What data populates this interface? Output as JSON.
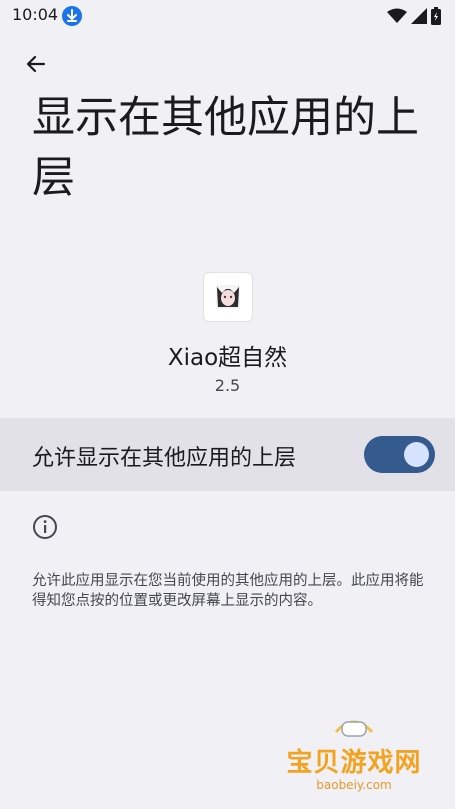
{
  "status_bar": {
    "time": "10:04"
  },
  "header": {
    "title": "显示在其他应用的上层"
  },
  "app": {
    "name": "Xiao超自然",
    "version": "2.5"
  },
  "permission": {
    "label": "允许显示在其他应用的上层",
    "enabled": true
  },
  "info": {
    "description": "允许此应用显示在您当前使用的其他应用的上层。此应用将能得知您点按的位置或更改屏幕上显示的内容。"
  },
  "watermark": {
    "text": "宝贝游戏网",
    "url": "baobeiy.com"
  },
  "colors": {
    "background": "#f1f0f4",
    "toggle_track": "#345a8e",
    "toggle_thumb": "#d6e3ff",
    "row_highlight": "#e2e1e8"
  }
}
